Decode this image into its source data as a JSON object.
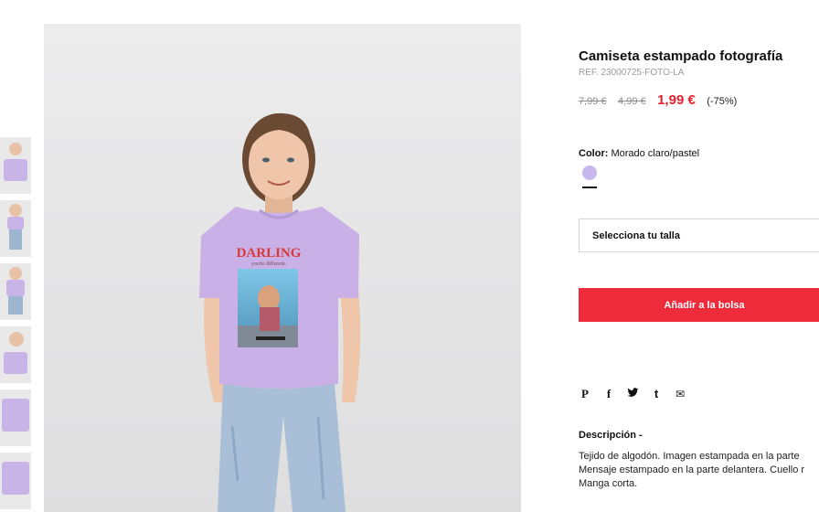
{
  "product": {
    "title": "Camiseta estampado fotografía",
    "ref": "REF. 23000725-FOTO-LA",
    "price_old_1": "7,99 €",
    "price_old_2": "4,99 €",
    "price_new": "1,99 €",
    "discount": "(-75%)",
    "color_label": "Color:",
    "color_value": "Morado claro/pastel",
    "size_placeholder": "Selecciona tu talla",
    "add_to_bag": "Añadir a la bolsa",
    "description_title": "Descripción -",
    "description_lines": [
      "Tejido de algodón. Imagen estampada en la parte",
      "Mensaje estampado en la parte delantera. Cuello r",
      "Manga corta."
    ]
  },
  "image": {
    "print_title": "DARLING",
    "print_subtitle": "you're different."
  },
  "social": {
    "pinterest": "P",
    "facebook": "f",
    "twitter": "t",
    "tumblr": "t",
    "email": "✉"
  },
  "colors": {
    "accent": "#ee2b3b",
    "swatch": "#c6b8ee"
  }
}
